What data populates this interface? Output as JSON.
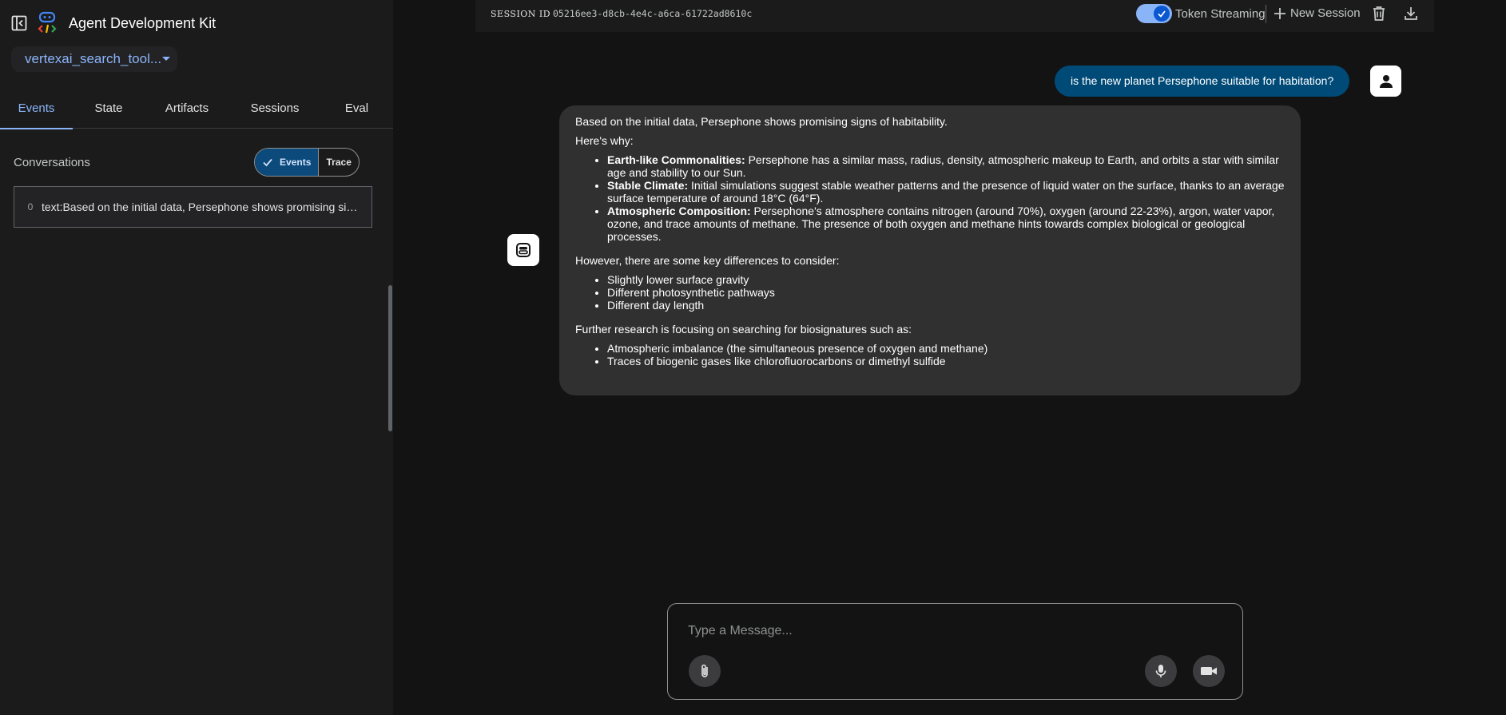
{
  "app": {
    "title": "Agent Development Kit"
  },
  "agent_select": {
    "value": "vertexai_search_tool..."
  },
  "tabs": [
    {
      "label": "Events"
    },
    {
      "label": "State"
    },
    {
      "label": "Artifacts"
    },
    {
      "label": "Sessions"
    },
    {
      "label": "Eval"
    }
  ],
  "conversations": {
    "label": "Conversations",
    "toggle": {
      "events": "Events",
      "trace": "Trace"
    },
    "events": [
      {
        "index": "0",
        "text": "text:Based on the initial data, Persephone shows promising signs of habitability."
      }
    ]
  },
  "topbar": {
    "session_label": "SESSION ID",
    "session_id": "05216ee3-d8cb-4e4c-a6ca-61722ad8610c",
    "streaming_label": "Token Streaming",
    "new_session_label": "New Session"
  },
  "chat": {
    "user_message": "is the new planet Persephone suitable for habitation?",
    "bot": {
      "intro": "Based on the initial data, Persephone shows promising signs of habitability.",
      "why": "Here's why:",
      "points": [
        {
          "title": "Earth-like Commonalities:",
          "text": " Persephone has a similar mass, radius, density, atmospheric makeup to Earth, and orbits a star with similar age and stability to our Sun."
        },
        {
          "title": "Stable Climate:",
          "text": " Initial simulations suggest stable weather patterns and the presence of liquid water on the surface, thanks to an average surface temperature of around 18°C (64°F)."
        },
        {
          "title": "Atmospheric Composition:",
          "text": " Persephone's atmosphere contains nitrogen (around 70%), oxygen (around 22-23%), argon, water vapor, ozone, and trace amounts of methane. The presence of both oxygen and methane hints towards complex biological or geological processes."
        }
      ],
      "differences_intro": "However, there are some key differences to consider:",
      "differences": [
        "Slightly lower surface gravity",
        "Different photosynthetic pathways",
        "Different day length"
      ],
      "research_intro": "Further research is focusing on searching for biosignatures such as:",
      "research": [
        "Atmospheric imbalance (the simultaneous presence of oxygen and methane)",
        "Traces of biogenic gases like chlorofluorocarbons or dimethyl sulfide"
      ]
    }
  },
  "composer": {
    "placeholder": "Type a Message..."
  },
  "colors": {
    "accent": "#8ab4f8",
    "user_bubble": "#004a77",
    "bot_bubble": "#303030",
    "background": "#131314",
    "sidebar": "#1b1b1c"
  },
  "icons": {
    "sidebar_toggle": "left-panel-close-icon",
    "logo": "adk-logo-icon",
    "check": "check-icon",
    "plus": "plus-icon",
    "trash": "trash-icon",
    "download": "download-icon",
    "user": "person-icon",
    "bot": "robot-icon",
    "attach": "paperclip-icon",
    "mic": "microphone-icon",
    "camera": "video-camera-icon"
  }
}
